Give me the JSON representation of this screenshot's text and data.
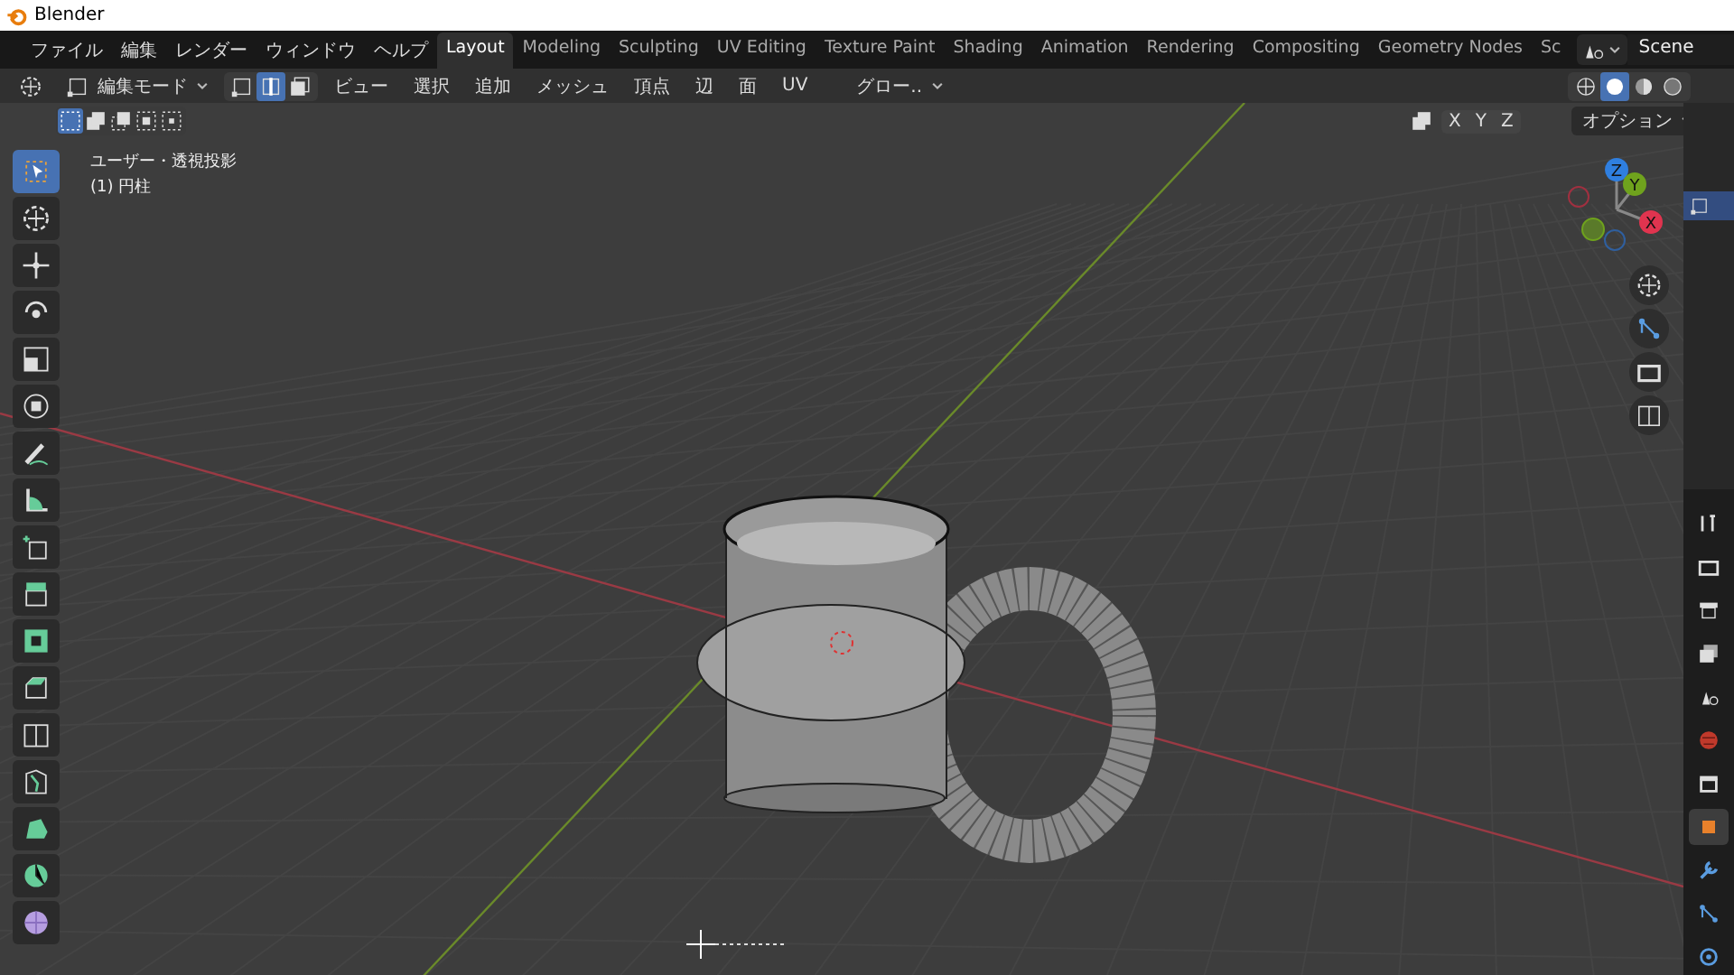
{
  "window": {
    "title": "Blender"
  },
  "menu": [
    "ファイル",
    "編集",
    "レンダー",
    "ウィンドウ",
    "ヘルプ"
  ],
  "workspaces": [
    {
      "label": "Layout",
      "selected": true
    },
    {
      "label": "Modeling",
      "selected": false
    },
    {
      "label": "Sculpting",
      "selected": false
    },
    {
      "label": "UV Editing",
      "selected": false
    },
    {
      "label": "Texture Paint",
      "selected": false
    },
    {
      "label": "Shading",
      "selected": false
    },
    {
      "label": "Animation",
      "selected": false
    },
    {
      "label": "Rendering",
      "selected": false
    },
    {
      "label": "Compositing",
      "selected": false
    },
    {
      "label": "Geometry Nodes",
      "selected": false
    },
    {
      "label": "Sc",
      "selected": false
    }
  ],
  "scene": {
    "name": "Scene"
  },
  "header": {
    "mode": "編集モード",
    "select_modes": [
      {
        "kind": "vertex",
        "selected": false
      },
      {
        "kind": "edge",
        "selected": true
      },
      {
        "kind": "face",
        "selected": false
      }
    ],
    "menus": [
      "ビュー",
      "選択",
      "追加",
      "メッシュ",
      "頂点",
      "辺",
      "面",
      "UV"
    ],
    "orientation": "グロー..",
    "shading": [
      {
        "kind": "wireframe",
        "selected": false
      },
      {
        "kind": "solid",
        "selected": true
      },
      {
        "kind": "material",
        "selected": false
      },
      {
        "kind": "rendered",
        "selected": false
      }
    ],
    "mirror_axes": [
      "X",
      "Y",
      "Z"
    ],
    "options": "オプション"
  },
  "box_modes": [
    {
      "kind": "new",
      "selected": true
    },
    {
      "kind": "extend",
      "selected": false
    },
    {
      "kind": "subtract",
      "selected": false
    },
    {
      "kind": "invert",
      "selected": false
    },
    {
      "kind": "intersect",
      "selected": false
    }
  ],
  "viewport": {
    "view_name": "ユーザー・透視投影",
    "object_label": "(1) 円柱"
  },
  "tools": [
    {
      "kind": "select",
      "selected": true
    },
    {
      "kind": "cursor",
      "selected": false
    },
    {
      "kind": "move",
      "selected": false
    },
    {
      "kind": "rotate",
      "selected": false
    },
    {
      "kind": "scale",
      "selected": false
    },
    {
      "kind": "transform",
      "selected": false
    },
    {
      "kind": "annotate",
      "selected": false
    },
    {
      "kind": "measure",
      "selected": false
    },
    {
      "kind": "add-cube",
      "selected": false
    },
    {
      "kind": "extrude",
      "selected": false
    },
    {
      "kind": "inset",
      "selected": false
    },
    {
      "kind": "bevel",
      "selected": false
    },
    {
      "kind": "loop-cut",
      "selected": false
    },
    {
      "kind": "knife",
      "selected": false
    },
    {
      "kind": "poly-build",
      "selected": false
    },
    {
      "kind": "spin",
      "selected": false
    },
    {
      "kind": "smooth",
      "selected": false
    }
  ],
  "gizmo": [
    {
      "label": "Z",
      "color": "#2f7fe0"
    },
    {
      "label": "Y",
      "color": "#6fa21d"
    },
    {
      "label": "X",
      "color": "#e0344f"
    }
  ],
  "properties_tabs": [
    {
      "kind": "tool",
      "selected": false
    },
    {
      "kind": "render",
      "selected": false
    },
    {
      "kind": "output",
      "selected": false
    },
    {
      "kind": "view-layer",
      "selected": false
    },
    {
      "kind": "scene",
      "selected": false
    },
    {
      "kind": "world",
      "selected": false
    },
    {
      "kind": "collection",
      "selected": false
    },
    {
      "kind": "object",
      "selected": true
    },
    {
      "kind": "modifier",
      "selected": false
    },
    {
      "kind": "particles",
      "selected": false
    },
    {
      "kind": "physics",
      "selected": false
    }
  ]
}
